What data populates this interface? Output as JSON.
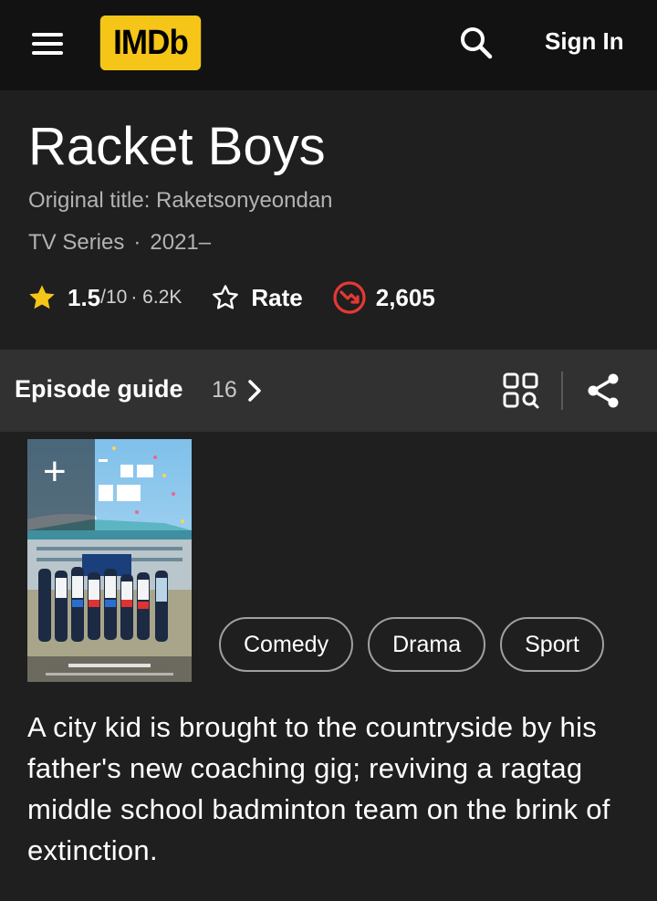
{
  "header": {
    "logo_text": "IMDb",
    "sign_in_label": "Sign In"
  },
  "title": {
    "name": "Racket Boys",
    "original_title": "Original title: Raketsonyeondan",
    "type": "TV Series",
    "separator": "·",
    "years": "2021–"
  },
  "rating": {
    "score": "1.5",
    "out_of": "/10",
    "votes": "· 6.2K",
    "rate_label": "Rate",
    "popularity": "2,605"
  },
  "episode_guide": {
    "label": "Episode guide",
    "count": "16"
  },
  "genres": [
    "Comedy",
    "Drama",
    "Sport"
  ],
  "plot": "A city kid is brought to the countryside by his father's new coaching gig; reviving a ragtag middle school badminton team on the brink of extinction.",
  "icons": {
    "menu": "hamburger-menu-icon",
    "search": "search-icon",
    "star": "star-icon",
    "rate_star": "star-outline-icon",
    "popularity": "trend-down-icon",
    "chevron": "chevron-right-icon",
    "grid": "grid-search-icon",
    "share": "share-icon",
    "add": "plus-icon"
  },
  "colors": {
    "brand_yellow": "#f5c518",
    "popularity_red": "#e53935",
    "background": "#1f1f1f",
    "header_bg": "#121212"
  }
}
